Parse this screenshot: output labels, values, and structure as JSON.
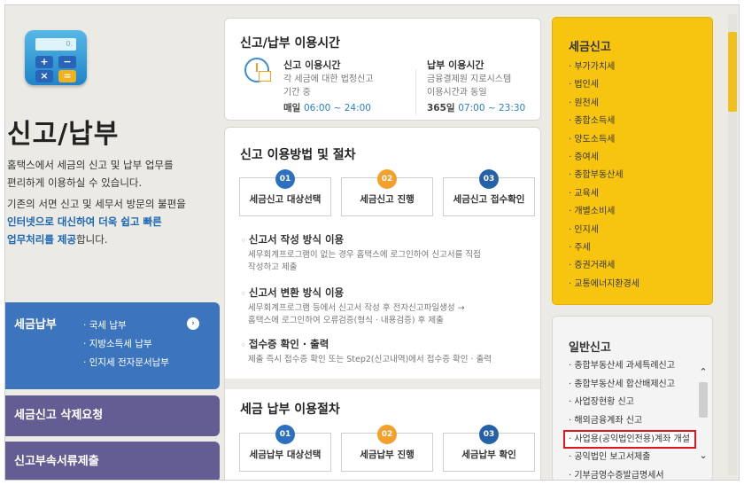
{
  "left": {
    "calc_screen": "0.",
    "calc_keys": [
      "+",
      "−",
      "×",
      "="
    ],
    "title": "신고/납부",
    "intro_line1": "홈택스에서 세금의 신고 및 납부 업무를",
    "intro_line2": "편리하게 이용하실 수 있습니다.",
    "intro2_line1": "기존의 서면 신고 및 세무서 방문의 불편을",
    "intro2_hl1": "인터넷으로 대신하여 더욱 쉽고 빠른",
    "intro2_hl2": "업무처리를 제공",
    "intro2_end": "합니다.",
    "pay_title": "세금납부",
    "pay_items": [
      "국세 납부",
      "지방소득세 납부",
      "인지세 전자문서납부"
    ],
    "pay_arrow": "›",
    "delete_request": "세금신고 삭제요청",
    "attach_submit": "신고부속서류제출"
  },
  "hours": {
    "title": "신고/납부 이용시간",
    "report": {
      "label": "신고 이용시간",
      "desc1": "각 세금에 대한 법정신고",
      "desc2": "기간 중",
      "prefix": "매일",
      "time": "06:00 ~ 24:00"
    },
    "pay": {
      "label": "납부 이용시간",
      "desc1": "금융결제원 지로시스템",
      "desc2": "이용시간과 동일",
      "prefix": "365일",
      "time": "07:00 ~ 23:30"
    }
  },
  "procedure": {
    "title": "신고 이용방법 및 절차",
    "steps": [
      {
        "num": "01",
        "label": "세금신고 대상선택"
      },
      {
        "num": "02",
        "label": "세금신고 진행"
      },
      {
        "num": "03",
        "label": "세금신고 접수확인"
      }
    ],
    "methods": [
      {
        "title": "신고서 작성 방식 이용",
        "desc1": "세무회계프로그램이 없는 경우 홈택스에 로그인하여 신고서를 직접",
        "desc2": "작성하고 제출"
      },
      {
        "title": "신고서 변환 방식 이용",
        "desc1": "세무회계프로그램 등에서 신고서 작성 후 전자신고파일생성 →",
        "desc2": "홈택스에 로그인하여 오류검증(형식 · 내용검증) 후 제출"
      },
      {
        "title": "접수증 확인 · 출력",
        "desc1": "제출 즉시 접수증 확인 또는 Step2(신고내역)에서 접수증 확인 · 출력",
        "desc2": ""
      }
    ],
    "pay_title": "세금 납부 이용절차",
    "pay_steps": [
      {
        "num": "01",
        "label": "세금납부 대상선택"
      },
      {
        "num": "02",
        "label": "세금납부 진행"
      },
      {
        "num": "03",
        "label": "세금납부 확인"
      }
    ]
  },
  "tax_report": {
    "title": "세금신고",
    "items": [
      "부가가치세",
      "법인세",
      "원천세",
      "종합소득세",
      "양도소득세",
      "증여세",
      "종합부동산세",
      "교육세",
      "개별소비세",
      "인지세",
      "주세",
      "증권거래세",
      "교통에너지환경세"
    ]
  },
  "general_report": {
    "title": "일반신고",
    "items": [
      "종합부동산세 과세특례신고",
      "종합부동산세 합산배제신고",
      "사업장현황 신고",
      "해외금융계좌 신고",
      "사업용(공익법인전용)계좌 개설",
      "공익법인 보고서제출",
      "기부금영수증발급명세서"
    ],
    "selected_index": 4
  }
}
